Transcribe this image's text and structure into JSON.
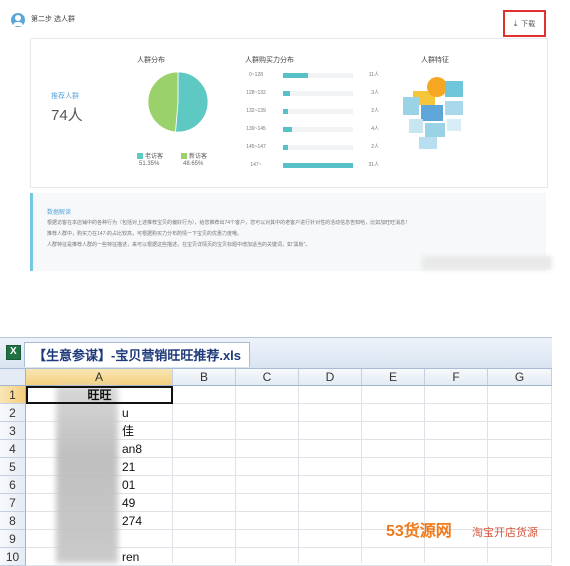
{
  "top": {
    "step_title": "第二步 选人群",
    "download_label": "下载",
    "recommended_label": "推荐人群",
    "recommended_count": "74人",
    "distribution_title": "人群分布",
    "purchase_title": "人群购买力分布",
    "traits_title": "人群特征",
    "distribution": {
      "slices": [
        {
          "label": "老访客",
          "percent": "51.35%",
          "value": 51.35,
          "color": "#5ec8c3"
        },
        {
          "label": "新访客",
          "percent": "48.65%",
          "value": 48.65,
          "color": "#9bd16a"
        }
      ]
    },
    "purchase_bars": [
      {
        "range": "0~128",
        "count_label": "11人",
        "count": 11
      },
      {
        "range": "128~132",
        "count_label": "3人",
        "count": 3
      },
      {
        "range": "132~139",
        "count_label": "2人",
        "count": 2
      },
      {
        "range": "139~145",
        "count_label": "4人",
        "count": 4
      },
      {
        "range": "145~147",
        "count_label": "2人",
        "count": 2
      },
      {
        "range": "147~",
        "count_label": "31人",
        "count": 31
      }
    ],
    "interpretation_title": "数据解读",
    "interpretation_lines": [
      "根据访客在本店铺中的各种行为（包括对上述推荐宝贝的偏好行为），给您推荐出74个客户，您可以对其中的老客户进行针对性的活动信息告知哈，比如加旺旺消息！",
      "推荐人群中，购买力在147-的占比较高，可根据购买力分布酌情一下宝贝的优惠力度哦。",
      "人群特征是推荐人群的一些特征描述，来可以根据这些描述，在宝贝详情页的宝贝标题中增加适当的关键词，如“黑板”。"
    ]
  },
  "excel": {
    "tab_label": "【生意参谋】-宝贝营销旺旺推荐.xls",
    "columns": [
      "A",
      "B",
      "C",
      "D",
      "E",
      "F",
      "G"
    ],
    "rows": [
      "1",
      "2",
      "3",
      "4",
      "5",
      "6",
      "7",
      "8",
      "9",
      "10"
    ],
    "cells_a": [
      "旺旺",
      "u",
      "佳",
      "an8",
      "21",
      "01",
      "49",
      "274",
      "",
      "ren"
    ]
  },
  "watermark": {
    "text": "53货源网",
    "site": "淘宝开店货源"
  }
}
